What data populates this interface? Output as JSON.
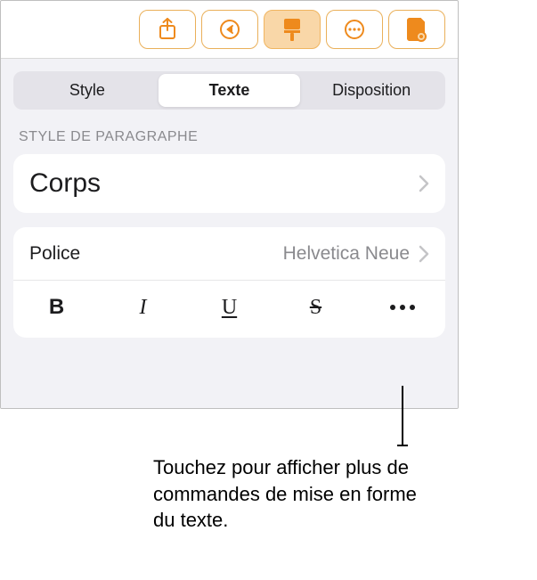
{
  "toolbar": {
    "share_icon": "share-icon",
    "undo_icon": "undo-icon",
    "format_icon": "brush-icon",
    "more_icon": "more-icon",
    "document_icon": "document-view-icon"
  },
  "tabs": {
    "style": "Style",
    "text": "Texte",
    "layout": "Disposition"
  },
  "section": {
    "paragraph_style_label": "STYLE DE PARAGRAPHE"
  },
  "paragraph_style": {
    "value": "Corps"
  },
  "font": {
    "label": "Police",
    "value": "Helvetica Neue"
  },
  "style_buttons": {
    "bold": "B",
    "italic": "I",
    "underline": "U",
    "strike": "S"
  },
  "callout": {
    "text": "Touchez pour afficher plus de commandes de mise en forme du texte."
  }
}
